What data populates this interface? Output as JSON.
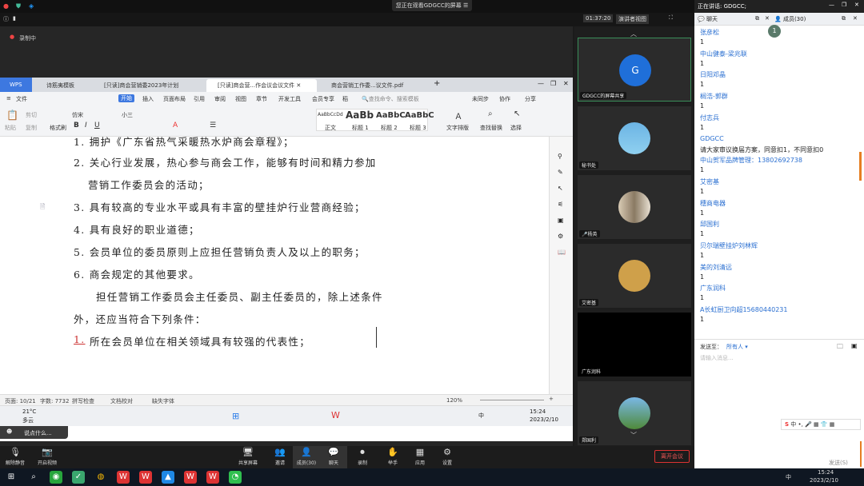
{
  "topbar": {
    "banner": "您正在观看GDGCC的屏幕",
    "speaker": "正在讲话: GDGCC;"
  },
  "bar2": {
    "timer": "01:37:20",
    "view": "演讲者视图"
  },
  "recording": {
    "label": "录制中"
  },
  "wps": {
    "logo": "WPS",
    "tabs": [
      "诗筋夷模板",
      "[只读]商会营销委2023年计划",
      "[只读]商会营...作会议会议文件",
      "商会营销工作委...议文件.pdf"
    ],
    "menu": [
      "文件",
      "开始",
      "插入",
      "页面布局",
      "引用",
      "审阅",
      "视图",
      "章节",
      "开发工具",
      "会员专享",
      "稻"
    ],
    "search": "查找命令、搜索模板",
    "sync": "未同步",
    "collab": "协作",
    "share": "分享",
    "toolbar": {
      "paste": "粘贴",
      "cut": "剪切",
      "copy": "复制",
      "format_painter": "格式刷",
      "font": "仿宋",
      "size": "小三",
      "styles": [
        "AaBbCcDd",
        "AaBb",
        "AaBbC",
        "AaBbC"
      ],
      "style_names": [
        "正文",
        "标题 1",
        "标题 2",
        "标题 3"
      ],
      "text_layout": "文字排版",
      "find_replace": "查找替换",
      "select": "选择"
    }
  },
  "doc": {
    "lines": [
      "1. 拥护《广东省热气采暖热水炉商会章程》；",
      "2. 关心行业发展，热心参与商会工作，能够有时间和精力参加",
      "营销工作委员会的活动；",
      "3. 具有较高的专业水平或具有丰富的壁挂炉行业营商经验；",
      "4. 具有良好的职业道德；",
      "5. 会员单位的委员原则上应担任营销负责人及以上的职务；",
      "6. 商会规定的其他要求。",
      "担任营销工作委员会主任委员、副主任委员的，除上述条件",
      "外，还应当符合下列条件：",
      "1.",
      "所在会员单位在相关领域具有较强的代表性；"
    ]
  },
  "status": {
    "page": "页面: 10/21",
    "words": "字数: 7732",
    "spell": "拼写检查",
    "doc_check": "文档校对",
    "missing_font": "缺失字体",
    "zoom": "120%"
  },
  "taskbar_inner": {
    "weather_temp": "21°C",
    "weather_desc": "多云",
    "lang": "中",
    "time": "15:24",
    "date": "2023/2/10"
  },
  "ime": {
    "label": "说点什么..."
  },
  "videos": [
    {
      "name": "GDGCC的屏幕共享",
      "initial": "G"
    },
    {
      "name": "秘书处"
    },
    {
      "name": "杨英"
    },
    {
      "name": "艾密基"
    },
    {
      "name": "广东润科"
    },
    {
      "name": "郑国利"
    }
  ],
  "chat": {
    "tab_chat": "聊天",
    "tab_members": "成员(30)",
    "badge": "1",
    "messages": [
      {
        "n": "张彦松",
        "v": "1"
      },
      {
        "n": "中山健泰-梁兆联",
        "v": "1"
      },
      {
        "n": "日阳邓晶",
        "v": "1"
      },
      {
        "n": "榈浩-郭群",
        "v": "1"
      },
      {
        "n": "付志兵",
        "v": "1"
      },
      {
        "n": "GDGCC",
        "v": "请大家审议换届方案，同意扣1，不同意扣0"
      },
      {
        "n": "中山贺军品牌管理：13802692738",
        "v": "1"
      },
      {
        "n": "艾密基",
        "v": "1"
      },
      {
        "n": "穗商电器",
        "v": "1"
      },
      {
        "n": "邱国利",
        "v": "1"
      },
      {
        "n": "贝尔瑞壁挂炉刘林辉",
        "v": "1"
      },
      {
        "n": "美的刘清远",
        "v": "1"
      },
      {
        "n": "广东润科",
        "v": "1"
      },
      {
        "n": "A长虹厨卫向超15680440231",
        "v": "1"
      }
    ],
    "send_to": "发送至：",
    "recipient": "所有人",
    "input_placeholder": "请输入消息...",
    "send": "发送(S)"
  },
  "controls": {
    "mute": "解除静音",
    "video": "开启视频",
    "share": "共享屏幕",
    "invite": "邀请",
    "members": "成员(30)",
    "chat": "聊天",
    "record": "录制",
    "raise": "举手",
    "apps": "应用",
    "settings": "设置",
    "leave": "离开会议"
  },
  "wintask": {
    "lang": "中",
    "time": "15:24",
    "date": "2023/2/10"
  }
}
